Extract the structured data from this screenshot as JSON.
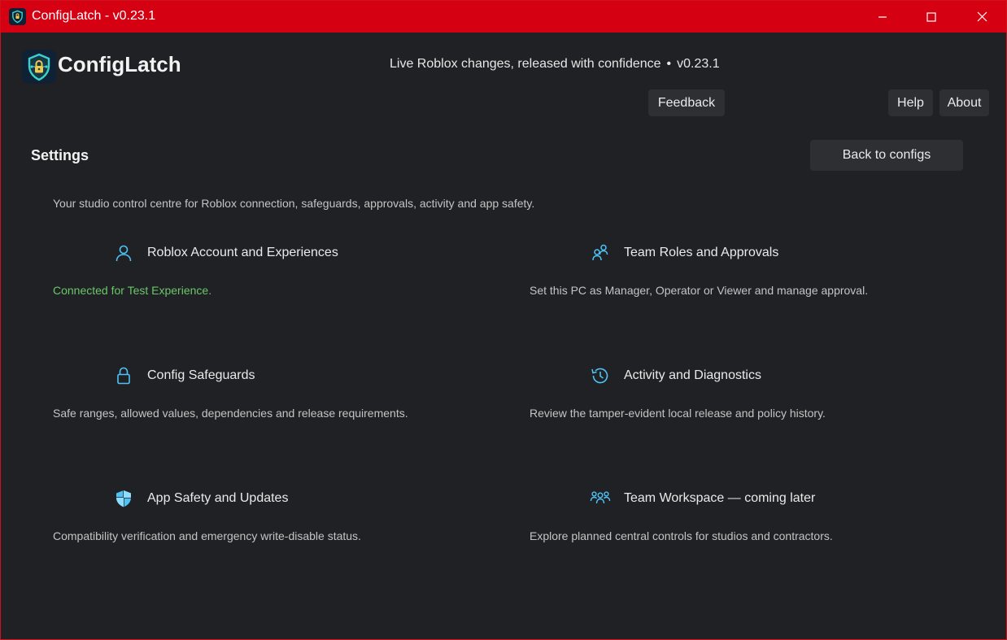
{
  "window": {
    "title": "ConfigLatch - v0.23.1",
    "controls": {
      "minimize_icon": "minimize-icon",
      "maximize_icon": "maximize-icon",
      "close_icon": "close-icon"
    },
    "accent_color": "#d60013"
  },
  "header": {
    "logo_text": "ConfigLatch",
    "logo_icon": "shield-lock-icon",
    "tagline_text": "Live Roblox changes, released with confidence",
    "tagline_separator": "•",
    "tagline_version": "v0.23.1",
    "buttons": {
      "feedback": "Feedback",
      "help": "Help",
      "about": "About"
    }
  },
  "settings": {
    "heading": "Settings",
    "back_button": "Back to configs",
    "intro": "Your studio control centre for Roblox connection, safeguards, approvals, activity and app safety.",
    "icon_color": "#4fc3f7",
    "success_color": "#6cc66b",
    "cards": [
      {
        "title": "Roblox Account and Experiences",
        "description": "Connected for Test Experience.",
        "icon": "person-icon",
        "status": "success"
      },
      {
        "title": "Team Roles and Approvals",
        "description": "Set this PC as Manager, Operator or Viewer and manage approval.",
        "icon": "team-roles-icon"
      },
      {
        "title": "Config Safeguards",
        "description": "Safe ranges, allowed values, dependencies and release requirements.",
        "icon": "lock-icon"
      },
      {
        "title": "Activity and Diagnostics",
        "description": "Review the tamper-evident local release and policy history.",
        "icon": "history-icon"
      },
      {
        "title": "App Safety and Updates",
        "description": "Compatibility verification and emergency write-disable status.",
        "icon": "shield-icon"
      },
      {
        "title": "Team Workspace — coming later",
        "description": "Explore planned central controls for studios and contractors.",
        "icon": "people-icon"
      }
    ]
  }
}
